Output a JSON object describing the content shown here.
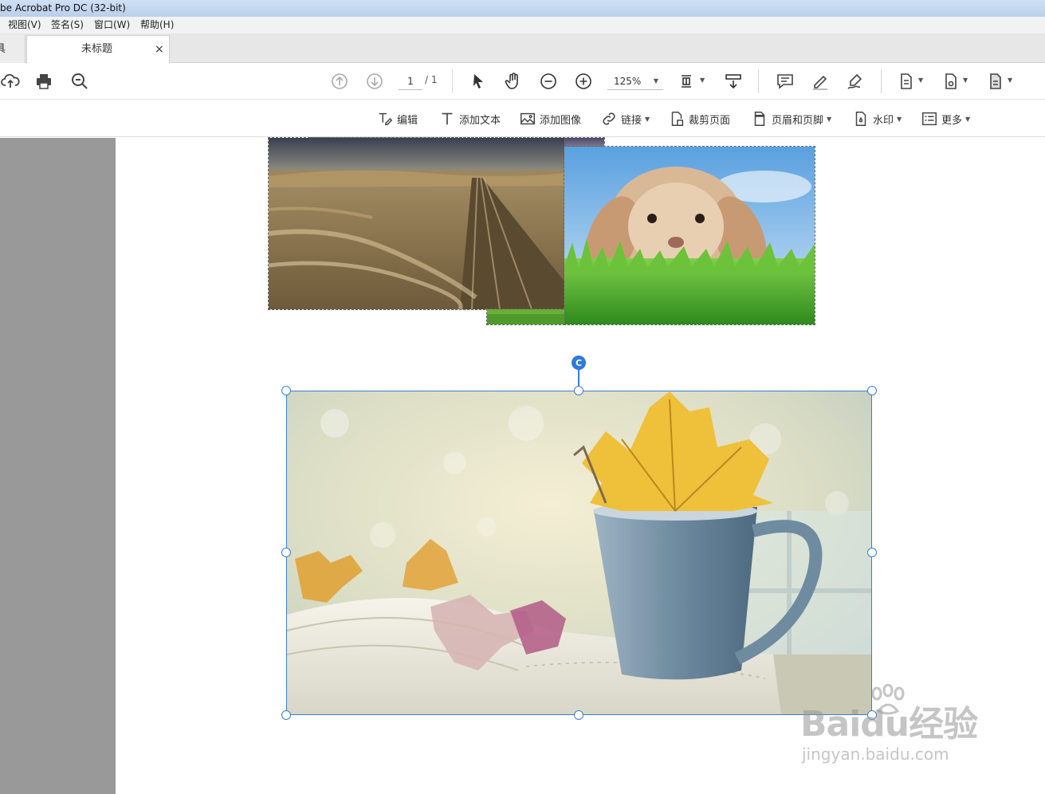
{
  "window": {
    "title": "be Acrobat Pro DC (32-bit)"
  },
  "menu": {
    "items": [
      "视图(V)",
      "签名(S)",
      "窗口(W)",
      "帮助(H)"
    ]
  },
  "tabs": {
    "stub_label": "具",
    "active_label": "未标题",
    "close_glyph": "×"
  },
  "toolbar": {
    "page_current": "1",
    "page_total": "/ 1",
    "zoom": "125%"
  },
  "edit_toolbar": {
    "edit": "编辑",
    "add_text": "添加文本",
    "add_image": "添加图像",
    "link": "链接",
    "crop": "裁剪页面",
    "header_footer": "页眉和页脚",
    "watermark": "水印",
    "more": "更多"
  },
  "selection": {
    "rotate_glyph": "C"
  },
  "watermark": {
    "brand": "Baidu经验",
    "url": "jingyan.baidu.com"
  },
  "colors": {
    "selection": "#3a7fd0",
    "left_pane": "#999999",
    "title_bar": "#c4d8ef"
  }
}
